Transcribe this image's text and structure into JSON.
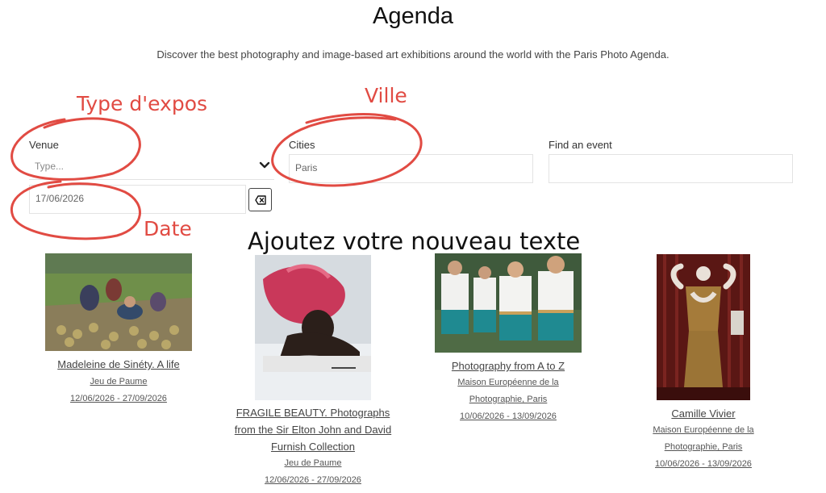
{
  "header": {
    "title": "Agenda",
    "subtitle": "Discover the best photography and image-based art exhibitions around the world with the Paris Photo Agenda."
  },
  "filters": {
    "venue_label": "Venue",
    "venue_placeholder": "Type...",
    "cities_label": "Cities",
    "cities_value": "Paris",
    "find_label": "Find an event",
    "find_value": "",
    "date_value": "17/06/2026"
  },
  "annotations": {
    "type": "Type d'expos",
    "ville": "Ville",
    "date": "Date",
    "overlay": "Ajoutez votre nouveau texte",
    "color": "#e14b43"
  },
  "events": [
    {
      "title_lines": [
        "Madeleine de Sinéty. A life"
      ],
      "venue_lines": [
        "Jeu de Paume"
      ],
      "dates": "12/06/2026 - 27/09/2026"
    },
    {
      "title_lines": [
        "FRAGILE BEAUTY. Photographs",
        "from the Sir Elton John and David",
        "Furnish Collection"
      ],
      "venue_lines": [
        "Jeu de Paume"
      ],
      "dates": "12/06/2026 - 27/09/2026"
    },
    {
      "title_lines": [
        "Photography from A to Z"
      ],
      "venue_lines": [
        "Maison Européenne de la",
        "Photographie, Paris"
      ],
      "dates": "10/06/2026 - 13/09/2026"
    },
    {
      "title_lines": [
        "Camille Vivier"
      ],
      "venue_lines": [
        "Maison Européenne de la",
        "Photographie, Paris"
      ],
      "dates": "10/06/2026 - 13/09/2026"
    }
  ]
}
